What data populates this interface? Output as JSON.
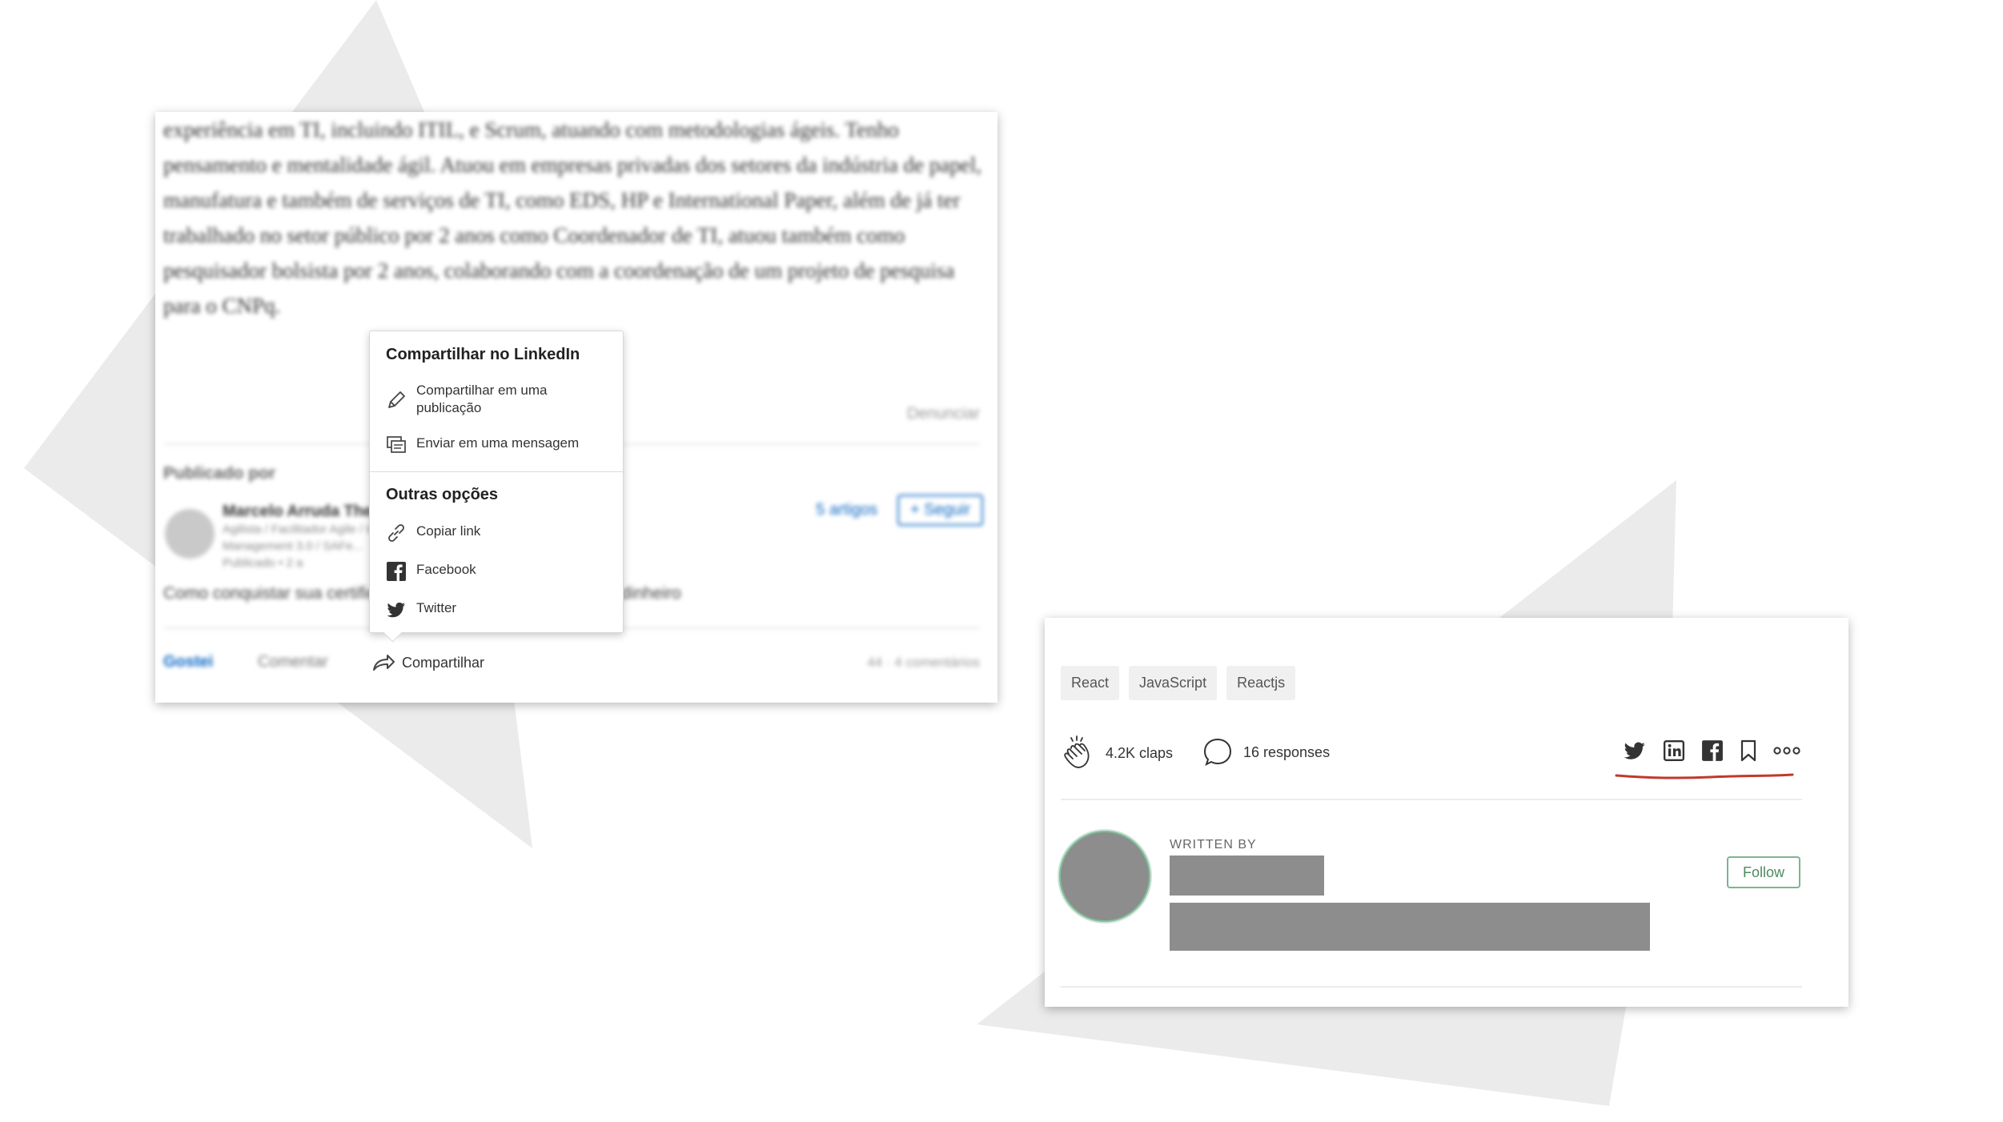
{
  "linkedin": {
    "article_text": "experiência em TI, incluindo ITIL, e Scrum, atuando com metodologias ágeis. Tenho pensamento e mentalidade ágil. Atuou em empresas privadas dos setores da indústria de papel, manufatura e também de serviços de TI, como EDS, HP e International Paper, além de já ter trabalhado no setor público por 2 anos como Coordenador de TI, atuou também como pesquisador bolsista por 2 anos, colaborando com a coordenação de um projeto de pesquisa para o CNPq.",
    "denunciar": "Denunciar",
    "published_by": "Publicado por",
    "author_name": "Marcelo Arruda The...",
    "author_line1": "Agilista / Facilitador Agile / Instrutor Certificado",
    "author_line2": "Management 3.0 / SAFe...",
    "author_line3": "Publicado • 2 a",
    "articles_link": "5 artigos",
    "follow_label": "+ Seguir",
    "related_text": "Como conquistar sua certificação... ITIL... sem gastar rios de dinheiro",
    "like_label": "Gostei",
    "comment_label": "Comentar",
    "share_label": "Compartilhar",
    "reactions_text": "44 · 4 comentários",
    "popup": {
      "section1_title": "Compartilhar no LinkedIn",
      "item_publicacao_line1": "Compartilhar em uma",
      "item_publicacao_line2": "publicação",
      "item_mensagem": "Enviar em uma mensagem",
      "section2_title": "Outras opções",
      "item_copiar": "Copiar link",
      "item_facebook": "Facebook",
      "item_twitter": "Twitter"
    }
  },
  "medium": {
    "tags": [
      "React",
      "JavaScript",
      "Reactjs"
    ],
    "claps": "4.2K claps",
    "responses": "16 responses",
    "social_icons": [
      "twitter-icon",
      "linkedin-icon",
      "facebook-icon",
      "bookmark-icon",
      "more-icon"
    ],
    "written_by": "WRITTEN BY",
    "follow": "Follow",
    "underline_color": "#c0392b",
    "follow_color": "#4d8a62"
  }
}
